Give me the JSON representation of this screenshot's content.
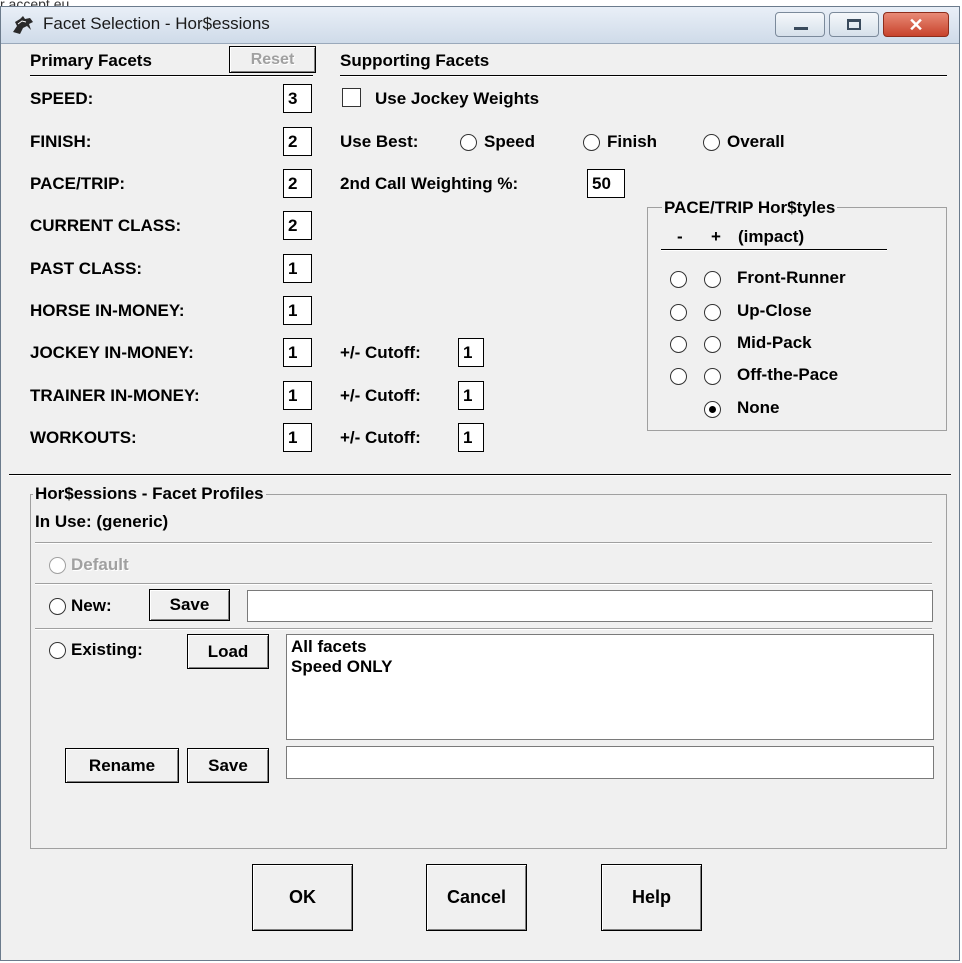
{
  "top_strip_text": "r accept eu",
  "window": {
    "title": "Facet Selection - Hor$essions",
    "icon": "horse-racing-icon"
  },
  "primary": {
    "header": "Primary Facets",
    "reset_label": "Reset",
    "facets": [
      {
        "label": "SPEED:",
        "value": "3"
      },
      {
        "label": "FINISH:",
        "value": "2"
      },
      {
        "label": "PACE/TRIP:",
        "value": "2"
      },
      {
        "label": "CURRENT CLASS:",
        "value": "2"
      },
      {
        "label": "PAST CLASS:",
        "value": "1"
      },
      {
        "label": "HORSE IN-MONEY:",
        "value": "1"
      },
      {
        "label": "JOCKEY IN-MONEY:",
        "value": "1"
      },
      {
        "label": "TRAINER IN-MONEY:",
        "value": "1"
      },
      {
        "label": "WORKOUTS:",
        "value": "1"
      }
    ]
  },
  "supporting": {
    "header": "Supporting Facets",
    "jockey_weights_label": "Use Jockey Weights",
    "use_best_label": "Use Best:",
    "use_best_options": [
      "Speed",
      "Finish",
      "Overall"
    ],
    "second_call_label": "2nd Call Weighting %:",
    "second_call_value": "50",
    "cutoff_label": "+/- Cutoff:",
    "horse_cutoff": "1",
    "jockey_cutoff": "1",
    "trainer_cutoff": "1"
  },
  "pace_group": {
    "title": "PACE/TRIP Hor$tyles",
    "minus": "-",
    "plus": "+",
    "impact": "(impact)",
    "options": [
      "Front-Runner",
      "Up-Close",
      "Mid-Pack",
      "Off-the-Pace"
    ],
    "none_label": "None",
    "selected": "None"
  },
  "profiles": {
    "title": "Hor$essions - Facet Profiles",
    "in_use": "In Use: (generic)",
    "default_label": "Default",
    "new_label": "New:",
    "save_label": "Save",
    "new_name": "",
    "existing_label": "Existing:",
    "load_label": "Load",
    "list": [
      "All facets",
      "Speed ONLY"
    ],
    "rename_label": "Rename",
    "save2_label": "Save",
    "rename_name": ""
  },
  "buttons": {
    "ok": "OK",
    "cancel": "Cancel",
    "help": "Help"
  }
}
